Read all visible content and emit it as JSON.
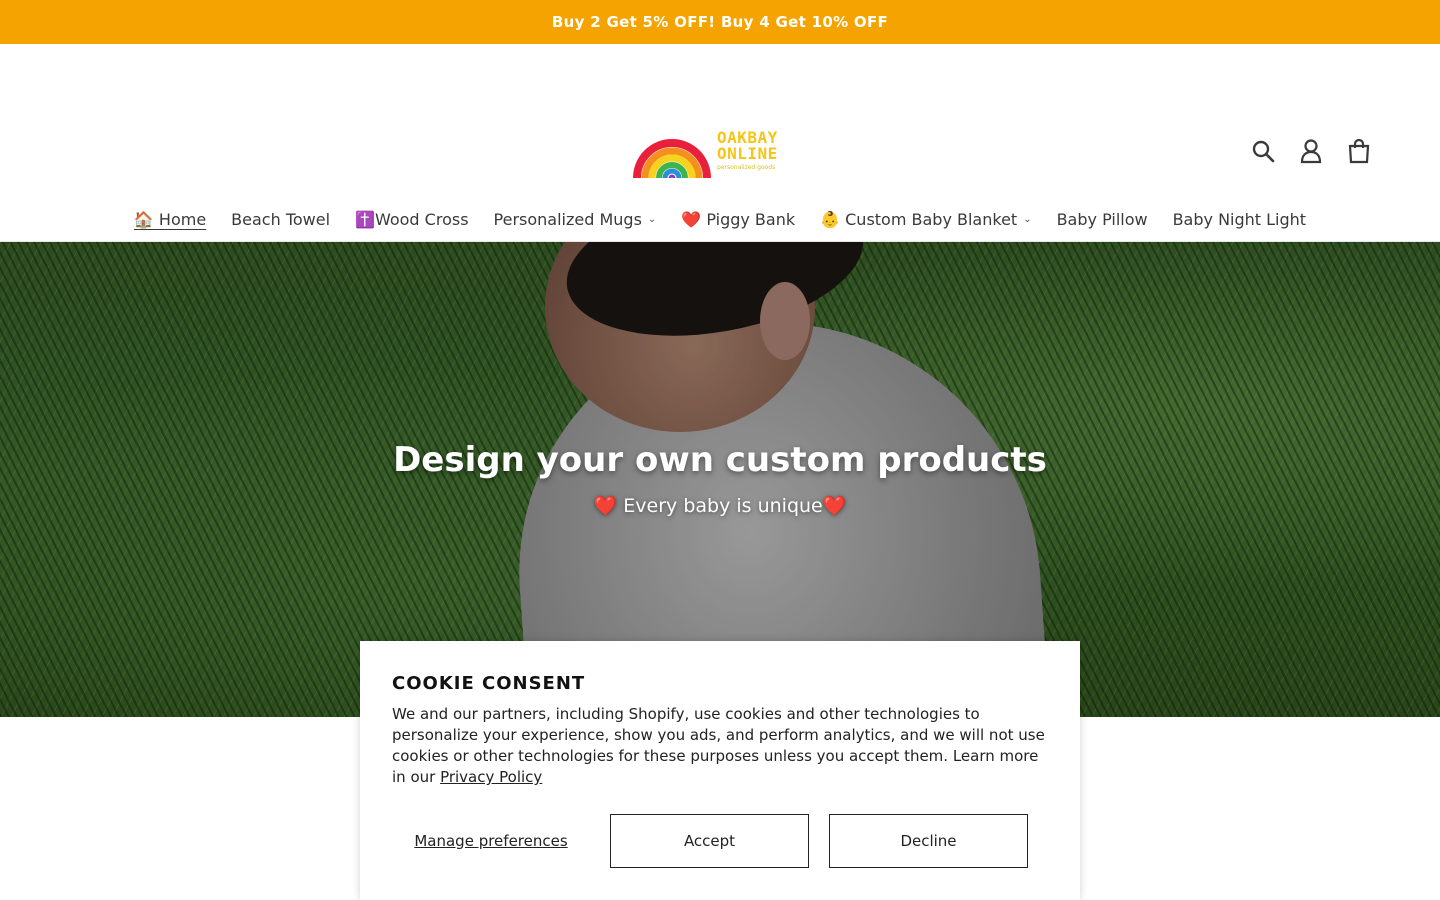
{
  "announcement": {
    "text": "Buy 2 Get 5% OFF! Buy 4 Get 10% OFF",
    "bg_color": "#f4a300"
  },
  "logo": {
    "line1": "OAKBAY",
    "line2": "ONLINE",
    "tagline": "personalized goods"
  },
  "header_icons": [
    "search-icon",
    "account-icon",
    "cart-icon"
  ],
  "nav": {
    "items": [
      {
        "label": "🏠 Home",
        "active": true,
        "dropdown": false
      },
      {
        "label": "Beach Towel",
        "dropdown": false
      },
      {
        "label": "✝️Wood Cross",
        "dropdown": false
      },
      {
        "label": "Personalized Mugs",
        "dropdown": true
      },
      {
        "label": "❤️ Piggy Bank",
        "dropdown": false
      },
      {
        "label": "👶 Custom Baby Blanket",
        "dropdown": true
      },
      {
        "label": "Baby Pillow",
        "dropdown": false
      },
      {
        "label": "Baby Night Light",
        "dropdown": false
      }
    ]
  },
  "hero": {
    "title": "Design your own custom products",
    "subtitle": "❤️ Every baby is unique❤️"
  },
  "cookie": {
    "title": "COOKIE CONSENT",
    "body": "We and our partners, including Shopify, use cookies and other technologies to personalize your experience, show you ads, and perform analytics, and we will not use cookies or other technologies for these purposes unless you accept them. Learn more in our ",
    "link": "Privacy Policy",
    "manage": "Manage preferences",
    "accept": "Accept",
    "decline": "Decline"
  }
}
